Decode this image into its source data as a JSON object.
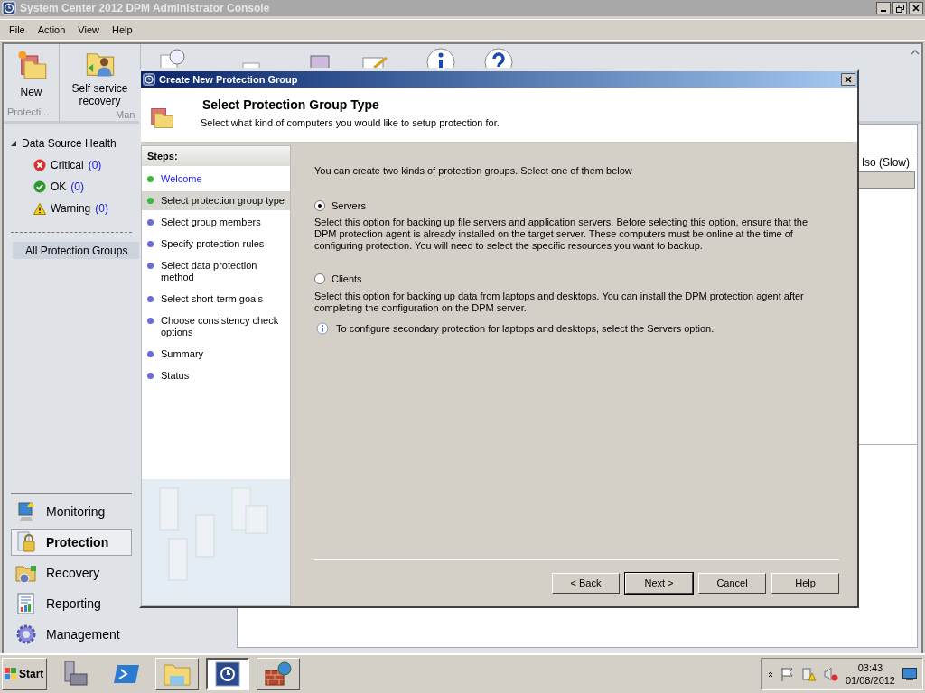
{
  "window": {
    "title": "System Center 2012 DPM Administrator Console"
  },
  "menu": [
    "File",
    "Action",
    "View",
    "Help"
  ],
  "ribbon": {
    "buttons": [
      {
        "kind": "new",
        "label": "New"
      },
      {
        "kind": "recovery",
        "label": "Self service recovery"
      }
    ],
    "groups": [
      "Protecti...",
      "Man"
    ]
  },
  "tree": {
    "title": "Data Source Health",
    "expanded": true,
    "items": [
      {
        "kind": "critical",
        "label": "Critical",
        "count": "(0)"
      },
      {
        "kind": "ok",
        "label": "OK",
        "count": "(0)"
      },
      {
        "kind": "warning",
        "label": "Warning",
        "count": "(0)"
      }
    ],
    "all_groups": {
      "label": "All Protection Groups",
      "selected": true
    }
  },
  "nav": [
    {
      "kind": "monitoring",
      "label": "Monitoring",
      "selected": false
    },
    {
      "kind": "protection",
      "label": "Protection",
      "selected": true
    },
    {
      "kind": "recovery",
      "label": "Recovery",
      "selected": false
    },
    {
      "kind": "reporting",
      "label": "Reporting",
      "selected": false
    },
    {
      "kind": "management",
      "label": "Management",
      "selected": false
    }
  ],
  "content": {
    "column_text": "lso (Slow)"
  },
  "dialog": {
    "title": "Create New Protection Group",
    "heading": "Select Protection Group Type",
    "subheading": "Select what kind of computers you would like to setup protection for.",
    "steps_title": "Steps:",
    "steps": [
      {
        "label": "Welcome",
        "color": "#3cb83c",
        "link": true,
        "selected": false
      },
      {
        "label": "Select protection group type",
        "color": "#3cb83c",
        "link": false,
        "selected": true
      },
      {
        "label": "Select group members",
        "color": "#6a6ad8",
        "link": false,
        "selected": false
      },
      {
        "label": "Specify protection rules",
        "color": "#6a6ad8",
        "link": false,
        "selected": false
      },
      {
        "label": "Select data protection method",
        "color": "#6a6ad8",
        "link": false,
        "selected": false
      },
      {
        "label": "Select short-term goals",
        "color": "#6a6ad8",
        "link": false,
        "selected": false
      },
      {
        "label": "Choose consistency check options",
        "color": "#6a6ad8",
        "link": false,
        "selected": false
      },
      {
        "label": "Summary",
        "color": "#6a6ad8",
        "link": false,
        "selected": false
      },
      {
        "label": "Status",
        "color": "#6a6ad8",
        "link": false,
        "selected": false
      }
    ],
    "intro": "You can create two kinds of protection groups. Select one of them below",
    "options": [
      {
        "label": "Servers",
        "selected": true,
        "description": "Select this option for backing up file servers and application servers. Before selecting this option, ensure that the DPM protection agent is already installed on the target server. These computers must be online at the time of configuring protection. You will need to select the specific resources you want to backup."
      },
      {
        "label": "Clients",
        "selected": false,
        "description": "Select this option for backing up data from laptops and desktops. You can install the DPM protection agent after completing the configuration on the DPM server."
      }
    ],
    "info_note": "To configure secondary protection for laptops and desktops, select the Servers option.",
    "buttons": [
      {
        "label": "< Back",
        "default": false
      },
      {
        "label": "Next >",
        "default": true
      },
      {
        "label": "Cancel",
        "default": false
      },
      {
        "label": "Help",
        "default": false
      }
    ]
  },
  "taskbar": {
    "start": "Start",
    "apps": [
      {
        "kind": "server-manager",
        "active": false
      },
      {
        "kind": "powershell",
        "active": false
      },
      {
        "kind": "explorer",
        "active": false
      },
      {
        "kind": "dpm",
        "active": true
      },
      {
        "kind": "firewall",
        "active": false
      }
    ],
    "tray": {
      "time": "03:43",
      "date": "01/08/2012"
    }
  }
}
